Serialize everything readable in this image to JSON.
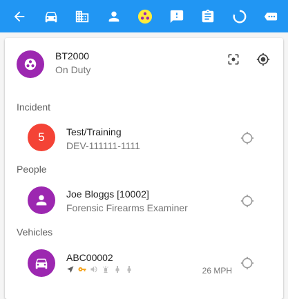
{
  "toolbar": {
    "buttons": [
      {
        "name": "back-arrow-icon"
      },
      {
        "name": "car-icon"
      },
      {
        "name": "building-icon"
      },
      {
        "name": "person-icon"
      },
      {
        "name": "unit-status-icon",
        "active": true
      },
      {
        "name": "alert-message-icon"
      },
      {
        "name": "clipboard-icon"
      },
      {
        "name": "progress-ring-icon"
      },
      {
        "name": "more-chip-icon"
      }
    ],
    "color": "#2196f3",
    "active_color": "#ffeb3b"
  },
  "unit": {
    "callsign": "BT2000",
    "status": "On Duty",
    "avatar_color": "#9c27b0"
  },
  "incident": {
    "header": "Incident",
    "badge": "5",
    "badge_color": "#f44336",
    "title": "Test/Training",
    "reference": "DEV-111111-1111"
  },
  "people": {
    "header": "People",
    "name": "Joe Bloggs [10002]",
    "role": "Forensic Firearms Examiner",
    "avatar_color": "#9c27b0"
  },
  "vehicles": {
    "header": "Vehicles",
    "registration": "ABC00002",
    "speed": "26 MPH",
    "avatar_color": "#9c27b0",
    "key_color": "#f5a623"
  }
}
